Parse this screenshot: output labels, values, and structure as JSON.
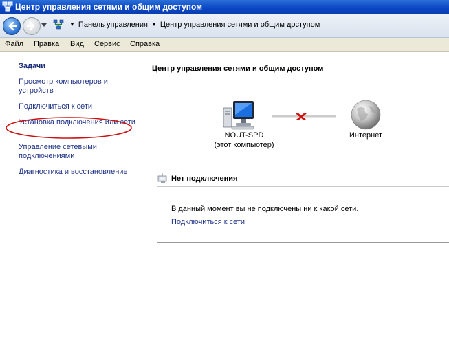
{
  "window": {
    "title": "Центр управления сетями и общим доступом"
  },
  "navbar": {
    "breadcrumb": [
      "Панель управления",
      "Центр управления сетями и общим доступом"
    ]
  },
  "menu": [
    "Файл",
    "Правка",
    "Вид",
    "Сервис",
    "Справка"
  ],
  "sidebar": {
    "header": "Задачи",
    "tasks": [
      "Просмотр компьютеров и устройств",
      "Подключиться к сети",
      "Установка подключения или сети",
      "Управление сетевыми подключениями",
      "Диагностика и восстановление"
    ],
    "highlight_color": "#d01010"
  },
  "main": {
    "title": "Центр управления сетями и общим доступом",
    "map": {
      "computer_name": "NOUT-SPD",
      "computer_sub": "(этот компьютер)",
      "internet_label": "Интернет",
      "link_status": "disconnected"
    },
    "status": {
      "title": "Нет подключения",
      "message": "В данный момент вы не подключены ни к какой сети.",
      "link": "Подключиться к сети"
    }
  }
}
